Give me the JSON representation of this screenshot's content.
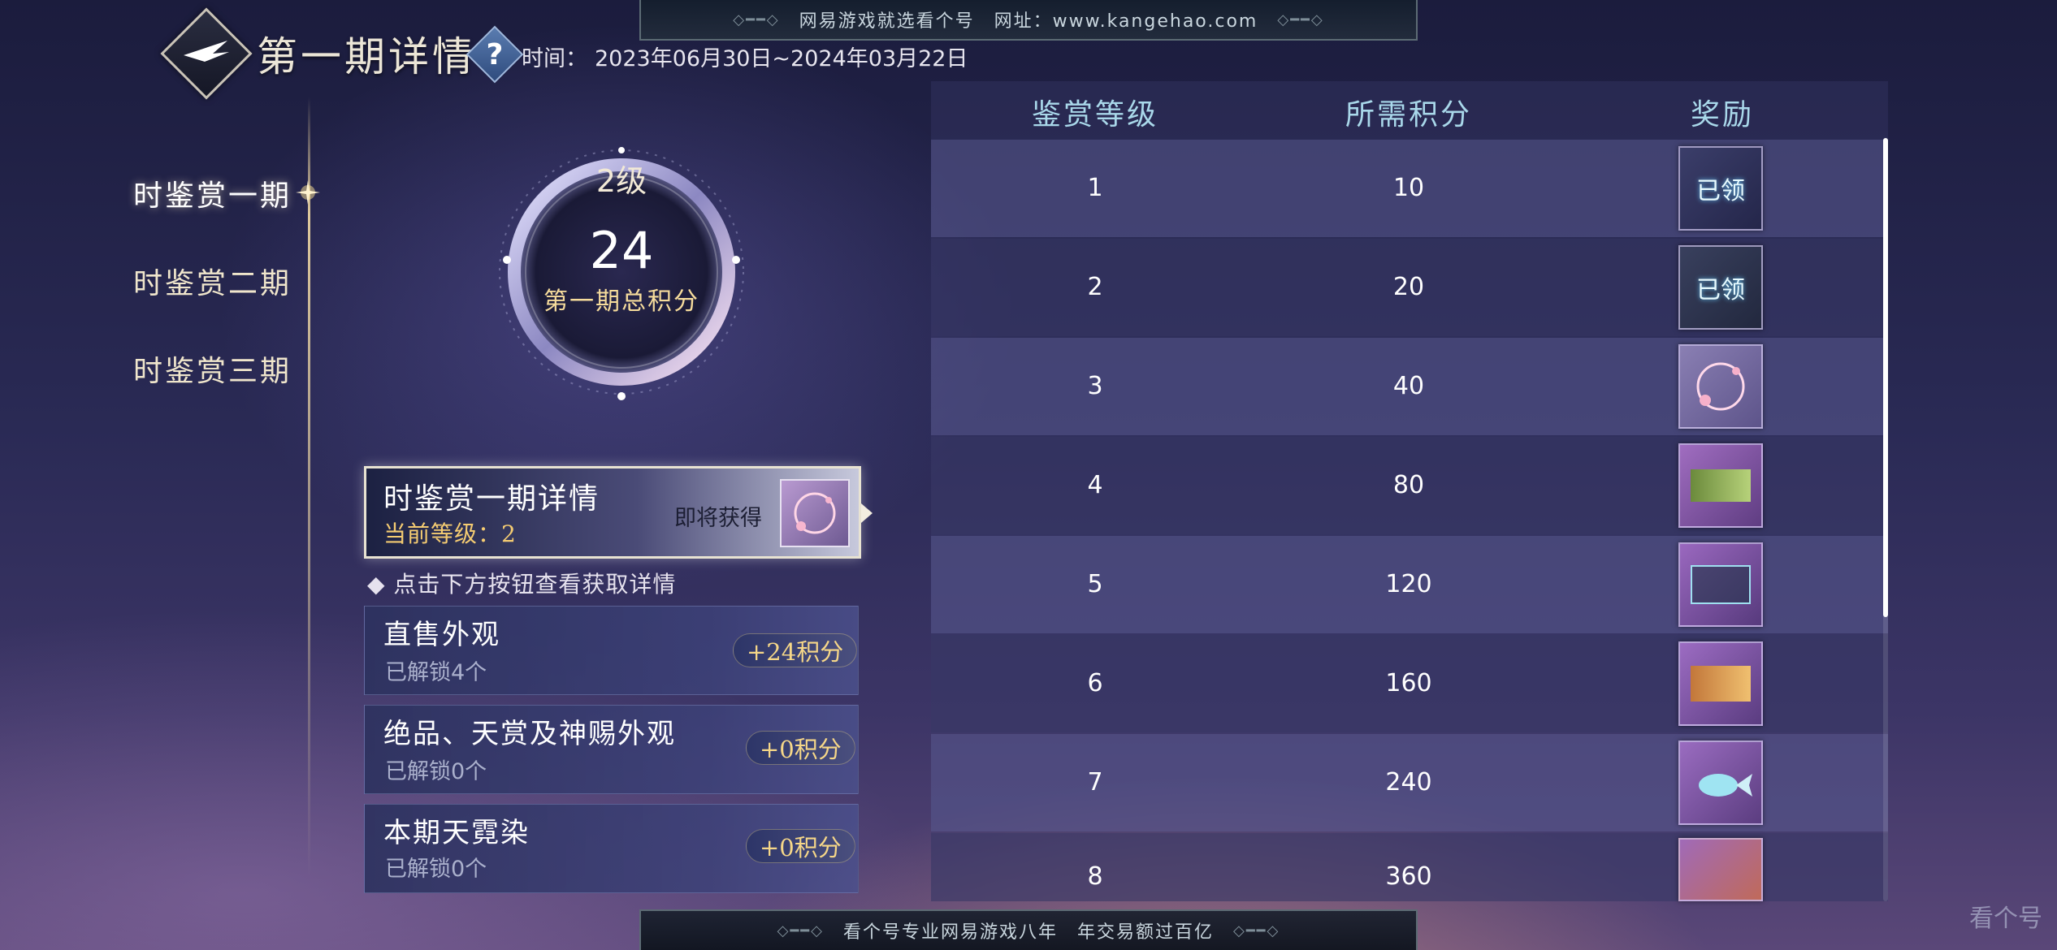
{
  "banners": {
    "top": "网易游戏就选看个号　网址：www.kangehao.com",
    "bottom": "看个号专业网易游戏八年　年交易额过百亿"
  },
  "header": {
    "title": "第一期详情",
    "help_icon": "?",
    "time_label": "时间：",
    "time_value": "2023年06月30日~2024年03月22日"
  },
  "sidebar": {
    "items": [
      {
        "label": "时鉴赏一期",
        "active": true
      },
      {
        "label": "时鉴赏二期",
        "active": false
      },
      {
        "label": "时鉴赏三期",
        "active": false
      }
    ]
  },
  "ring": {
    "level": "2级",
    "score": "24",
    "label": "第一期总积分"
  },
  "detail_card": {
    "title": "时鉴赏一期详情",
    "level_text": "当前等级：2",
    "soon_label": "即将获得"
  },
  "hint": "◆ 点击下方按钮查看获取详情",
  "sources": [
    {
      "title": "直售外观",
      "sub": "已解锁4个",
      "points": "+24积分"
    },
    {
      "title": "绝品、天赏及神赐外观",
      "sub": "已解锁0个",
      "points": "+0积分"
    },
    {
      "title": "本期天霓染",
      "sub": "已解锁0个",
      "points": "+0积分"
    }
  ],
  "table": {
    "headers": [
      "鉴赏等级",
      "所需积分",
      "奖励"
    ],
    "rows": [
      {
        "level": "1",
        "points": "10",
        "reward": "已领"
      },
      {
        "level": "2",
        "points": "20",
        "reward": "已领"
      },
      {
        "level": "3",
        "points": "40",
        "reward": ""
      },
      {
        "level": "4",
        "points": "80",
        "reward": ""
      },
      {
        "level": "5",
        "points": "120",
        "reward": ""
      },
      {
        "level": "6",
        "points": "160",
        "reward": ""
      },
      {
        "level": "7",
        "points": "240",
        "reward": ""
      },
      {
        "level": "8",
        "points": "360",
        "reward": ""
      }
    ]
  },
  "watermark": "看个号",
  "colors": {
    "accent_gold": "#f5cc72",
    "header_blue": "#a9d8ea",
    "background": "#2a2a55"
  }
}
